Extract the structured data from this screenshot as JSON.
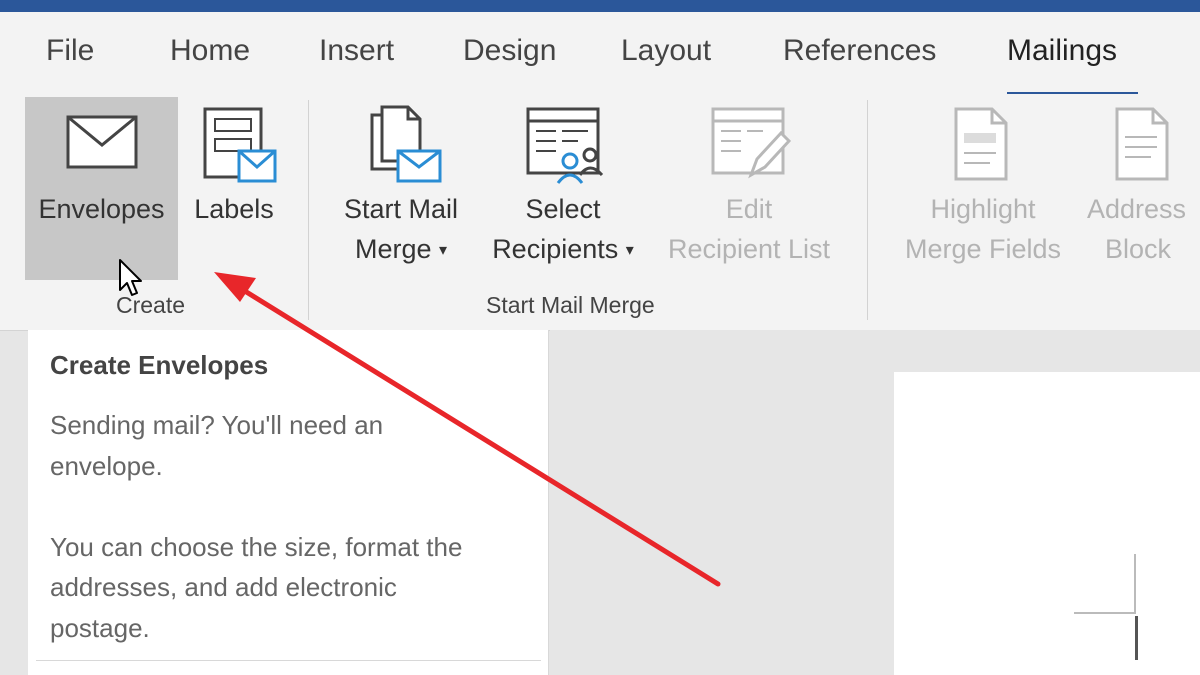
{
  "tabs": [
    {
      "label": "File"
    },
    {
      "label": "Home"
    },
    {
      "label": "Insert"
    },
    {
      "label": "Design"
    },
    {
      "label": "Layout"
    },
    {
      "label": "References"
    },
    {
      "label": "Mailings",
      "active": true
    }
  ],
  "ribbon": {
    "create_group": {
      "label": "Create",
      "envelopes": {
        "label": "Envelopes",
        "icon": "envelope-icon"
      },
      "labels": {
        "label": "Labels",
        "icon": "labels-icon"
      }
    },
    "start_mail_merge_group": {
      "label": "Start Mail Merge",
      "start_mail_merge": {
        "line1": "Start Mail",
        "line2": "Merge",
        "caret": "▾",
        "icon": "start-mail-merge-icon"
      },
      "select_recipients": {
        "line1": "Select",
        "line2": "Recipients",
        "caret": "▾",
        "icon": "select-recipients-icon"
      },
      "edit_recipient_list": {
        "line1": "Edit",
        "line2": "Recipient List",
        "icon": "edit-recipient-list-icon",
        "disabled": true
      }
    },
    "write_insert_group": {
      "highlight_merge_fields": {
        "line1": "Highlight",
        "line2": "Merge Fields",
        "icon": "highlight-merge-fields-icon",
        "disabled": true
      },
      "address_block": {
        "line1": "Address",
        "line2": "Block",
        "icon": "address-block-icon",
        "disabled": true
      }
    }
  },
  "tooltip": {
    "title": "Create Envelopes",
    "lines": [
      "Sending mail? You'll need an",
      "envelope.",
      "You can choose the size, format the",
      "addresses, and add electronic",
      "postage."
    ]
  },
  "colors": {
    "accent": "#2b579a",
    "annotation_arrow": "#e8262a"
  }
}
